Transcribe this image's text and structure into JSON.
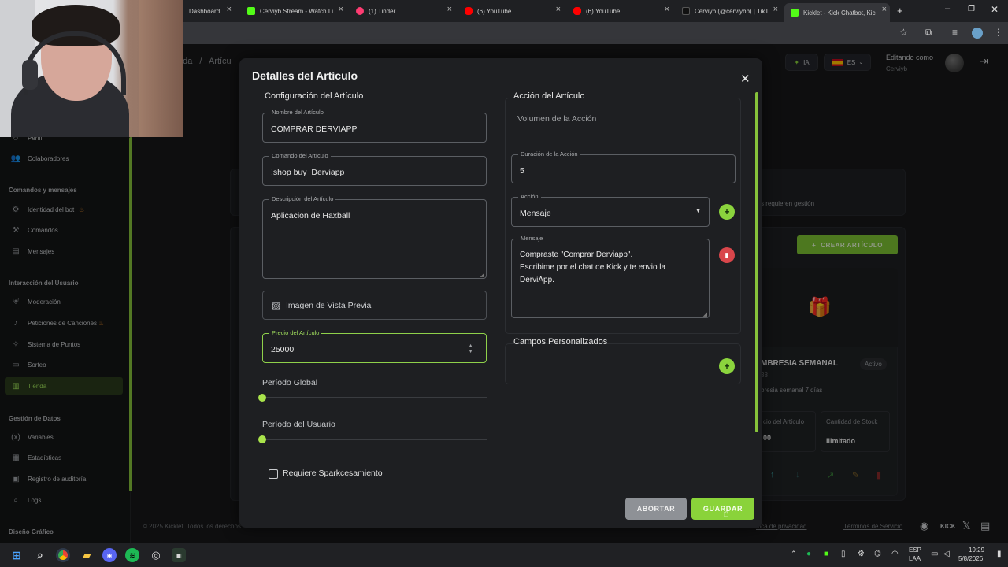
{
  "browser": {
    "tabs": [
      {
        "label": "Dashboard",
        "color": "#3b82f6"
      },
      {
        "label": "Cerviyb Stream - Watch Li",
        "color": "#53fc18"
      },
      {
        "label": "(1) Tinder",
        "color": "#fe3c72"
      },
      {
        "label": "(6) YouTube",
        "color": "#ff0000"
      },
      {
        "label": "(6) YouTube",
        "color": "#ff0000"
      },
      {
        "label": "Cerviyb (@cerviybb) | TikT",
        "color": "#111111"
      },
      {
        "label": "Kicklet - Kick Chatbot, Kic",
        "color": "#53fc18"
      }
    ]
  },
  "header": {
    "breadcrumb_a": "nda",
    "breadcrumb_sep": "/",
    "breadcrumb_b": "Artícu",
    "ai_label": "IA",
    "lang_label": "ES",
    "editing_label": "Editando como",
    "editing_user": "Cerviyb"
  },
  "sidebar": {
    "items_top": [
      {
        "label": "Perfil",
        "icon": "person-icon"
      },
      {
        "label": "Colaboradores",
        "icon": "people-icon"
      }
    ],
    "section_commands": "Comandos y mensajes",
    "items_commands": [
      {
        "label": "Identidad del bot",
        "icon": "bot-icon"
      },
      {
        "label": "Comandos",
        "icon": "hammer-icon"
      },
      {
        "label": "Mensajes",
        "icon": "message-icon"
      }
    ],
    "section_interaction": "Interacción del Usuario",
    "items_interaction": [
      {
        "label": "Moderación",
        "icon": "shield-icon"
      },
      {
        "label": "Peticiones de Canciones",
        "icon": "music-icon"
      },
      {
        "label": "Sistema de Puntos",
        "icon": "points-icon"
      },
      {
        "label": "Sorteo",
        "icon": "ticket-icon"
      },
      {
        "label": "Tienda",
        "icon": "store-icon"
      }
    ],
    "section_data": "Gestión de Datos",
    "items_data": [
      {
        "label": "Variables",
        "icon": "variable-icon"
      },
      {
        "label": "Estadísticas",
        "icon": "stats-icon"
      },
      {
        "label": "Registro de auditoría",
        "icon": "audit-icon"
      },
      {
        "label": "Logs",
        "icon": "logs-icon"
      }
    ],
    "section_design": "Diseño Gráfico"
  },
  "background": {
    "requires_text": "s requieren gestión",
    "create_button": "CREAR ARTÍCULO",
    "item_name": "MBRESIA SEMANAL",
    "item_status": "Activo",
    "item_number": "38",
    "item_desc": "bresia semanal 7 días",
    "price_label": "cio del Artículo",
    "price_value": "00",
    "stock_label": "Cantidad de Stock",
    "stock_value": "Ilimitado",
    "footer": "© 2025 Kicklet. Todos los derechos",
    "privacy": "ítica de privacidad",
    "terms": "Términos de Servicio"
  },
  "modal": {
    "title": "Detalles del Artículo",
    "config_title": "Configuración del Artículo",
    "name_label": "Nombre del Artículo",
    "name_value": "COMPRAR DERVIAPP",
    "command_label": "Comando del Artículo",
    "command_value": "!shop buy  Derviapp",
    "desc_label": "Descripción del Artículo",
    "desc_value": "Aplicacion de Haxball",
    "preview_label": "Imagen de Vista Previa",
    "price_label": "Precio del Artículo",
    "price_value": "25000",
    "global_period": "Período Global",
    "user_period": "Período del Usuario",
    "requires_label": "Requiere Sparkcesamiento",
    "action_title": "Acción del Artículo",
    "volume_label": "Volumen de la Acción",
    "duration_label": "Duración de la Acción",
    "duration_value": "5",
    "action_label": "Acción",
    "action_value": "Mensaje",
    "message_label": "Mensaje",
    "message_value": "Compraste \"Comprar Derviapp\".\nEscribime por el chat de Kick y te envio la\nDerviApp.",
    "custom_fields_title": "Campos Personalizados",
    "abort_button": "ABORTAR",
    "save_button": "GUARDAR"
  },
  "taskbar": {
    "lang_top": "ESP",
    "lang_bottom": "LAA",
    "time": "19:29",
    "date": "5/8/2026"
  },
  "colors": {
    "accent": "#8ad33a",
    "danger": "#d9464b"
  }
}
